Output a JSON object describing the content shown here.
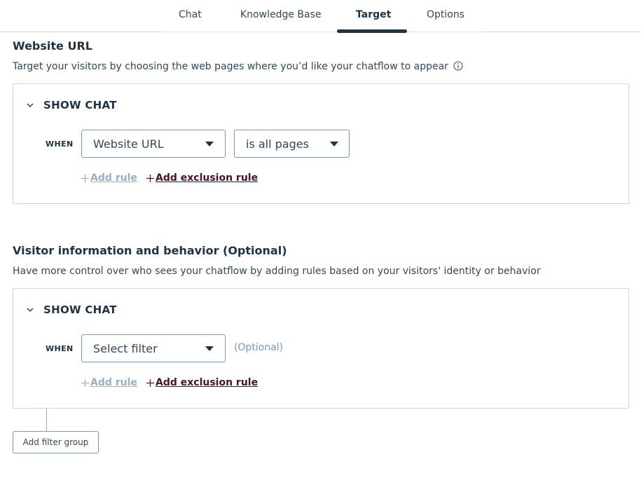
{
  "tabs": [
    {
      "label": "Chat"
    },
    {
      "label": "Knowledge Base"
    },
    {
      "label": "Target"
    },
    {
      "label": "Options"
    }
  ],
  "active_tab": "Target",
  "website_section": {
    "title": "Website URL",
    "description": "Target your visitors by choosing the web pages where you’d like your chatflow to appear",
    "show_chat_label": "SHOW CHAT",
    "when_label": "WHEN",
    "filter_select": "Website URL",
    "condition_select": "is all pages",
    "add_rule_label": "Add rule",
    "add_exclusion_label": "Add exclusion rule"
  },
  "visitor_section": {
    "title": "Visitor information and behavior (Optional)",
    "description": "Have more control over who sees your chatflow by adding rules based on your visitors' identity or behavior",
    "show_chat_label": "SHOW CHAT",
    "when_label": "WHEN",
    "filter_select": "Select filter",
    "optional_label": "(Optional)",
    "add_rule_label": "Add rule",
    "add_exclusion_label": "Add exclusion rule"
  },
  "add_filter_group_label": "Add filter group",
  "icons": {
    "info": "info-icon",
    "collapse": "chevron-down-icon",
    "dropdown": "caret-down-icon",
    "add": "plus-icon"
  },
  "colors": {
    "text_primary": "#213343",
    "border": "#cbd6e2",
    "link_active": "#4a1230",
    "link_disabled": "#99afc4",
    "tab_indicator": "#213343"
  }
}
